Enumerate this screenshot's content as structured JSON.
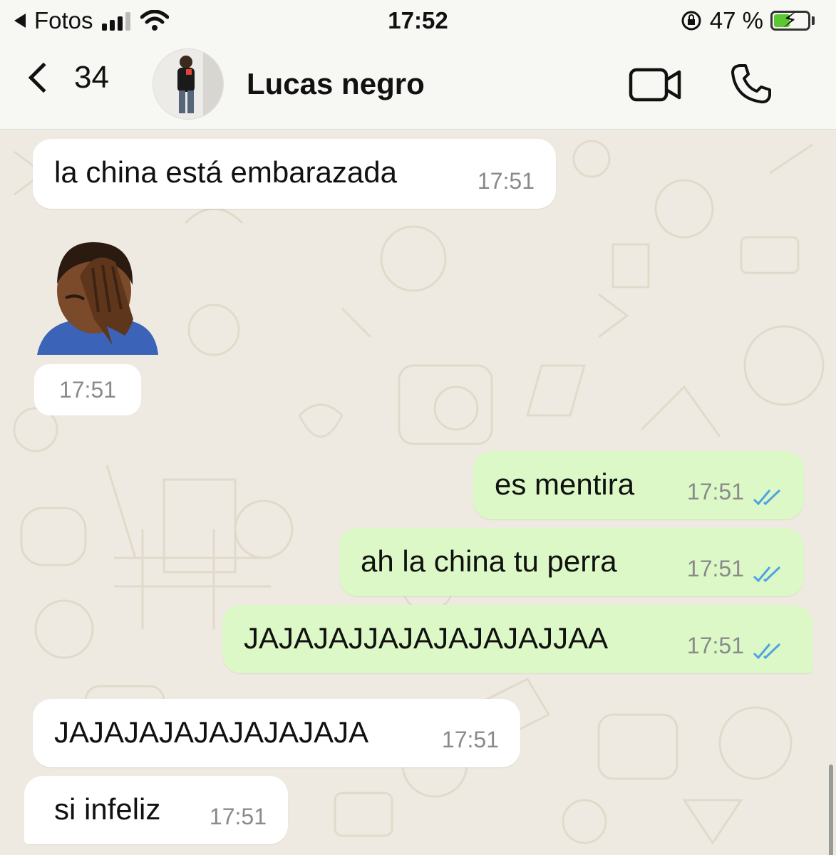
{
  "status_bar": {
    "back_app": "Fotos",
    "time": "17:52",
    "battery_percent": "47 %",
    "battery_level": 0.47
  },
  "header": {
    "back_count": "34",
    "contact_name": "Lucas negro"
  },
  "messages": [
    {
      "direction": "incoming",
      "text": "la china está embarazada",
      "time": "17:51"
    },
    {
      "direction": "incoming",
      "type": "sticker",
      "emoji": "facepalm-emoji",
      "time": "17:51"
    },
    {
      "direction": "outgoing",
      "text": "es mentira",
      "time": "17:51",
      "read": true
    },
    {
      "direction": "outgoing",
      "text": "ah la china tu perra",
      "time": "17:51",
      "read": true
    },
    {
      "direction": "outgoing",
      "text": "JAJAJAJJAJAJAJAJAJJAA",
      "time": "17:51",
      "read": true
    },
    {
      "direction": "incoming",
      "text": "JAJAJAJAJAJAJAJAJA",
      "time": "17:51"
    },
    {
      "direction": "incoming",
      "text": "si infeliz",
      "time": "17:51"
    }
  ],
  "colors": {
    "outgoing_bubble": "#dcf8c6",
    "incoming_bubble": "#ffffff",
    "read_ticks": "#4fa3e0",
    "battery_fill": "#5ac832"
  }
}
